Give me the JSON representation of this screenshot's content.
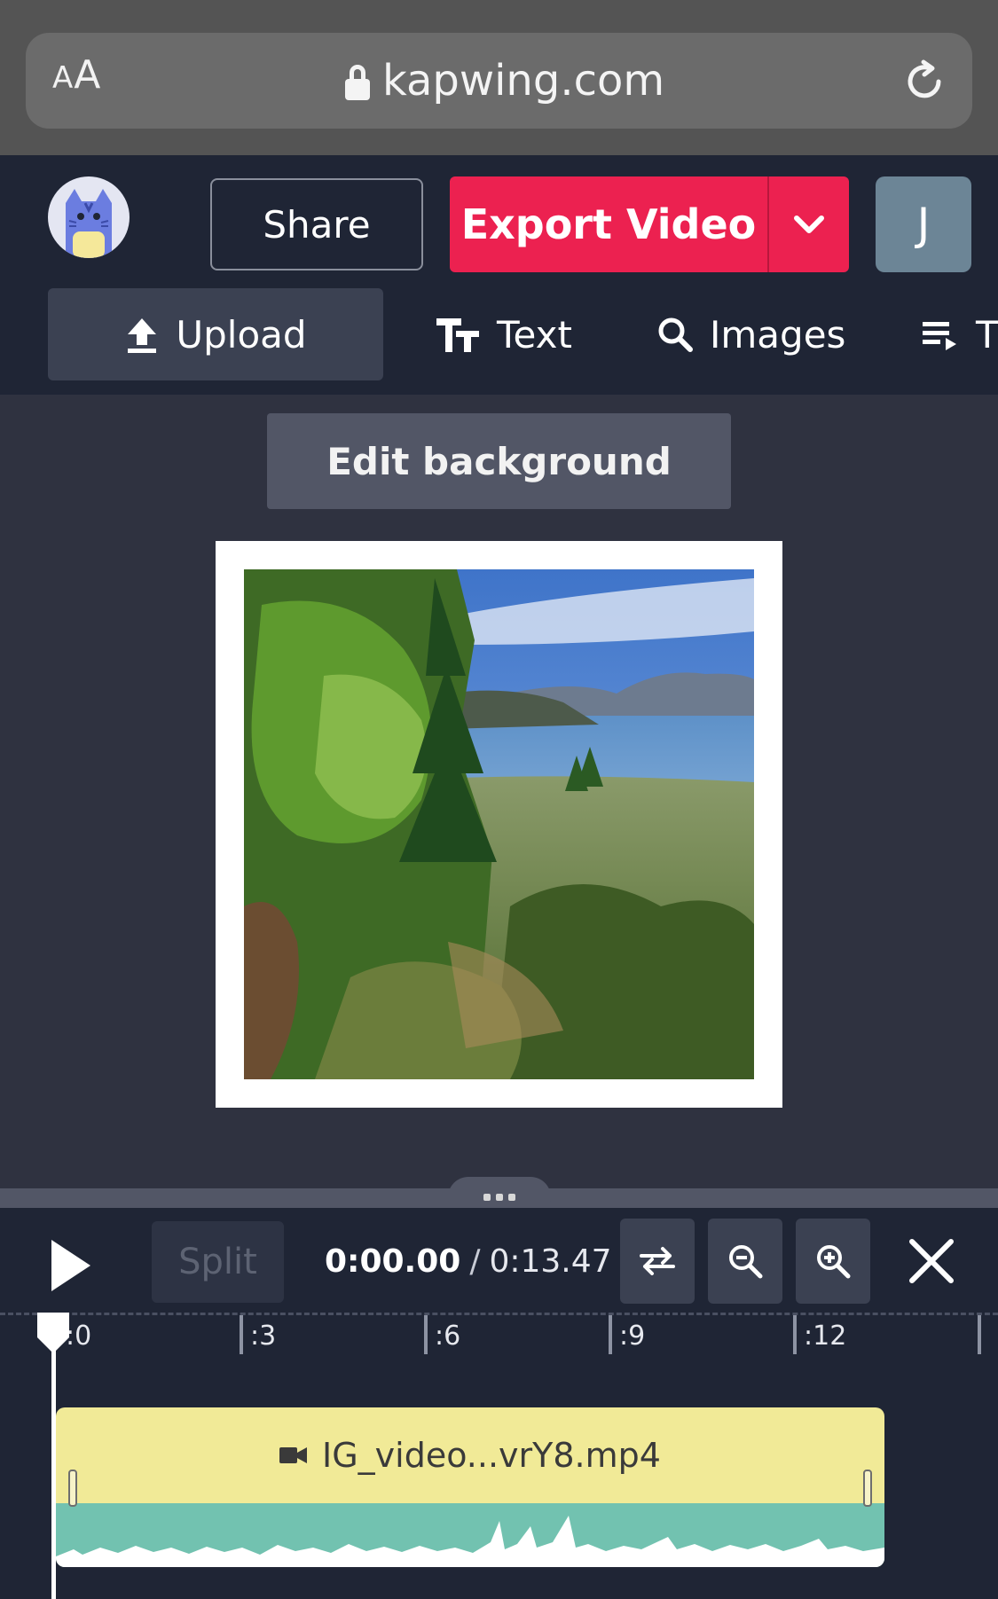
{
  "browser": {
    "text_size_label_small": "A",
    "text_size_label_large": "A",
    "url": "kapwing.com"
  },
  "header": {
    "share_label": "Share",
    "export_label": "Export Video",
    "user_initial": "J"
  },
  "tools": {
    "upload_label": "Upload",
    "text_label": "Text",
    "images_label": "Images",
    "more_label": "T"
  },
  "canvas": {
    "edit_background_label": "Edit background"
  },
  "timeline": {
    "split_label": "Split",
    "current_time": "0:00.00",
    "separator": "/",
    "duration": "0:13.47",
    "ticks": [
      ":0",
      ":3",
      ":6",
      ":9",
      ":12"
    ],
    "clip_name": "IG_video...vrY8.mp4"
  },
  "colors": {
    "accent": "#ec2150",
    "header_bg": "#1f2535",
    "canvas_bg": "#2f3240",
    "clip_bg": "#f1ea97",
    "wave_bg": "#72c2b0"
  }
}
